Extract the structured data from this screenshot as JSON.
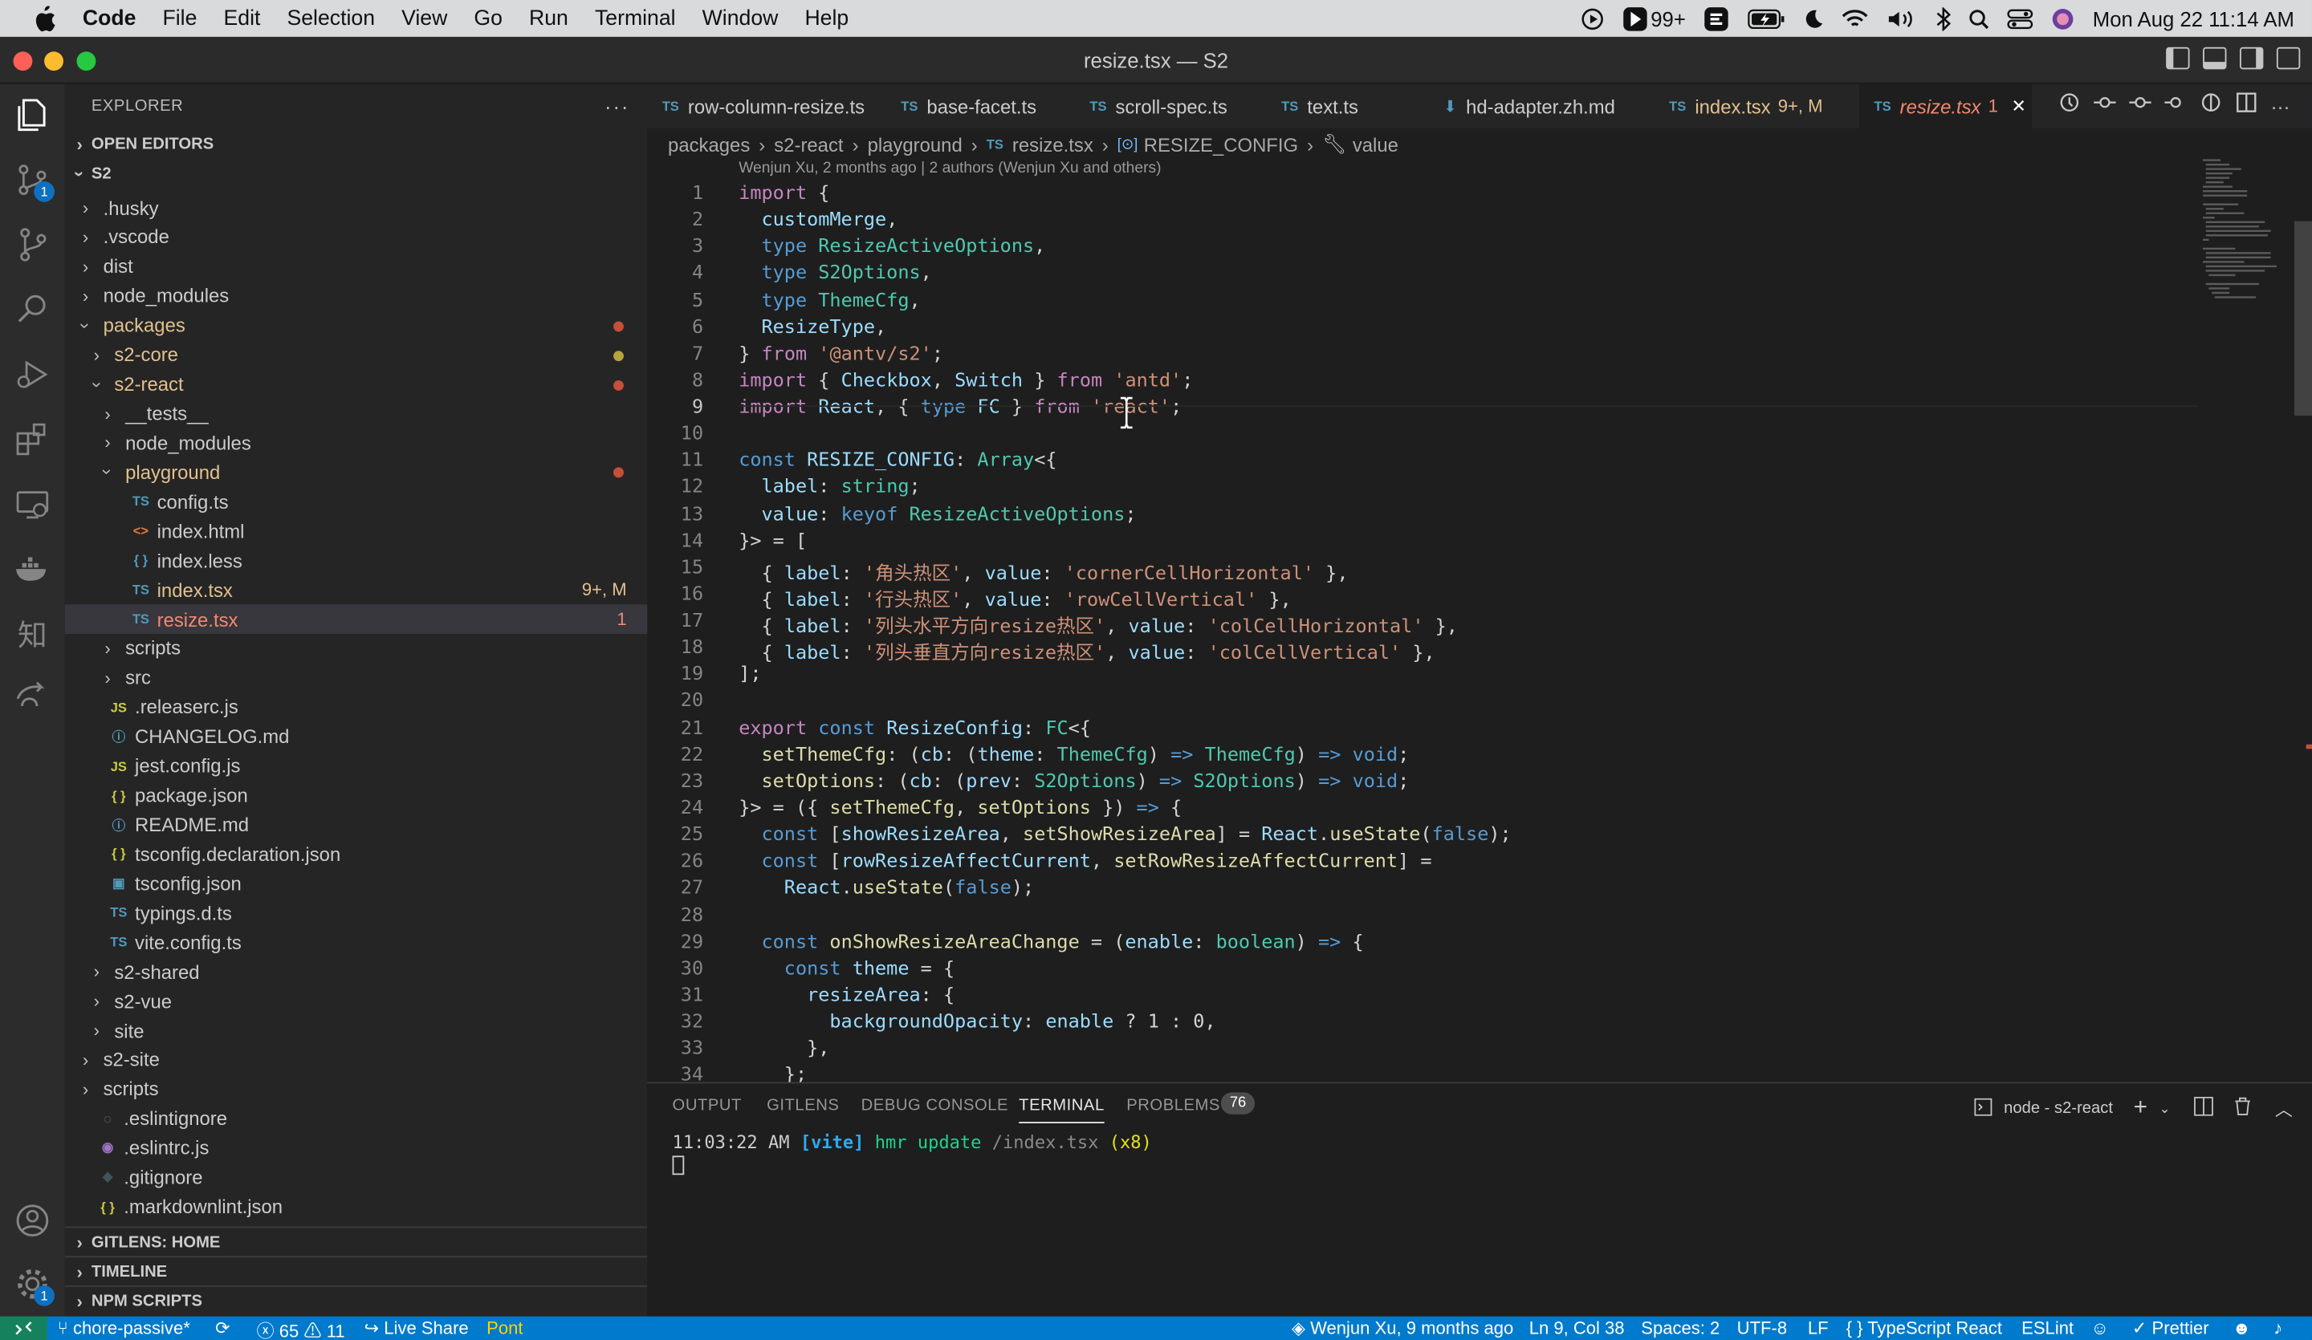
{
  "menubar": {
    "items": [
      "Code",
      "File",
      "Edit",
      "Selection",
      "View",
      "Go",
      "Run",
      "Terminal",
      "Window",
      "Help"
    ],
    "notifications": "99+",
    "datetime": "Mon Aug 22  11:14 AM"
  },
  "window": {
    "title": "resize.tsx — S2"
  },
  "sidebar": {
    "header": "EXPLORER",
    "open_editors": "OPEN EDITORS",
    "root": "S2",
    "tree": [
      {
        "name": ".husky",
        "type": "folder",
        "depth": 1
      },
      {
        "name": ".vscode",
        "type": "folder",
        "depth": 1
      },
      {
        "name": "dist",
        "type": "folder",
        "depth": 1
      },
      {
        "name": "node_modules",
        "type": "folder",
        "depth": 1
      },
      {
        "name": "packages",
        "type": "folder-open",
        "depth": 1,
        "color": "#e2c08d",
        "dot": "#c74e39"
      },
      {
        "name": "s2-core",
        "type": "folder",
        "depth": 2,
        "color": "#e2c08d",
        "dot": "#b5a33f"
      },
      {
        "name": "s2-react",
        "type": "folder-open",
        "depth": 2,
        "color": "#e2c08d",
        "dot": "#c74e39"
      },
      {
        "name": "__tests__",
        "type": "folder",
        "depth": 3
      },
      {
        "name": "node_modules",
        "type": "folder",
        "depth": 3
      },
      {
        "name": "playground",
        "type": "folder-open",
        "depth": 3,
        "color": "#e2c08d",
        "dot": "#c74e39"
      },
      {
        "name": "config.ts",
        "type": "TS",
        "depth": 4
      },
      {
        "name": "index.html",
        "type": "HTML",
        "depth": 4
      },
      {
        "name": "index.less",
        "type": "LESS",
        "depth": 4
      },
      {
        "name": "index.tsx",
        "type": "TS",
        "depth": 4,
        "color": "#e2c08d",
        "deco": "9+, M"
      },
      {
        "name": "resize.tsx",
        "type": "TS",
        "depth": 4,
        "color": "#f48771",
        "deco": "1",
        "selected": true
      },
      {
        "name": "scripts",
        "type": "folder",
        "depth": 3
      },
      {
        "name": "src",
        "type": "folder",
        "depth": 3
      },
      {
        "name": ".releaserc.js",
        "type": "JS",
        "depth": 2
      },
      {
        "name": "CHANGELOG.md",
        "type": "INFO",
        "depth": 2
      },
      {
        "name": "jest.config.js",
        "type": "JS",
        "depth": 2
      },
      {
        "name": "package.json",
        "type": "JSON",
        "depth": 2
      },
      {
        "name": "README.md",
        "type": "INFO",
        "depth": 2
      },
      {
        "name": "tsconfig.declaration.json",
        "type": "JSON",
        "depth": 2
      },
      {
        "name": "tsconfig.json",
        "type": "TSCONF",
        "depth": 2
      },
      {
        "name": "typings.d.ts",
        "type": "TS",
        "depth": 2
      },
      {
        "name": "vite.config.ts",
        "type": "TS",
        "depth": 2
      },
      {
        "name": "s2-shared",
        "type": "folder",
        "depth": 2
      },
      {
        "name": "s2-vue",
        "type": "folder",
        "depth": 2
      },
      {
        "name": "site",
        "type": "folder",
        "depth": 2
      },
      {
        "name": "s2-site",
        "type": "folder",
        "depth": 1
      },
      {
        "name": "scripts",
        "type": "folder",
        "depth": 1
      },
      {
        "name": ".eslintignore",
        "type": "IGNORE",
        "depth": 1
      },
      {
        "name": ".eslintrc.js",
        "type": "ESLINT",
        "depth": 1
      },
      {
        "name": ".gitignore",
        "type": "GIT",
        "depth": 1
      },
      {
        "name": ".markdownlint.json",
        "type": "JSON",
        "depth": 1
      }
    ],
    "sections": [
      "GITLENS: HOME",
      "TIMELINE",
      "NPM SCRIPTS"
    ]
  },
  "tabs": [
    {
      "label": "row-column-resize.ts",
      "icon": "TS"
    },
    {
      "label": "base-facet.ts",
      "icon": "TS"
    },
    {
      "label": "scroll-spec.ts",
      "icon": "TS"
    },
    {
      "label": "text.ts",
      "icon": "TS"
    },
    {
      "label": "hd-adapter.zh.md",
      "icon": "MD"
    },
    {
      "label": "index.tsx",
      "icon": "TS",
      "deco": "9+, M"
    },
    {
      "label": "resize.tsx",
      "icon": "TS",
      "deco": "1",
      "active": true
    },
    {
      "label": "",
      "icon": "T"
    }
  ],
  "breadcrumb": [
    "packages",
    "s2-react",
    "playground",
    "resize.tsx",
    "RESIZE_CONFIG",
    "value"
  ],
  "blame": "Wenjun Xu, 2 months ago | 2 authors (Wenjun Xu and others)",
  "code_lines": [
    [
      [
        "kw",
        "import"
      ],
      [
        "p",
        " {"
      ]
    ],
    [
      [
        "v",
        "  customMerge"
      ],
      [
        "p",
        ","
      ]
    ],
    [
      [
        "k",
        "  type "
      ],
      [
        "t",
        "ResizeActiveOptions"
      ],
      [
        "p",
        ","
      ]
    ],
    [
      [
        "k",
        "  type "
      ],
      [
        "t",
        "S2Options"
      ],
      [
        "p",
        ","
      ]
    ],
    [
      [
        "k",
        "  type "
      ],
      [
        "t",
        "ThemeCfg"
      ],
      [
        "p",
        ","
      ]
    ],
    [
      [
        "v",
        "  ResizeType"
      ],
      [
        "p",
        ","
      ]
    ],
    [
      [
        "p",
        "} "
      ],
      [
        "kw",
        "from"
      ],
      [
        "s",
        " '@antv/s2'"
      ],
      [
        "p",
        ";"
      ]
    ],
    [
      [
        "kw",
        "import"
      ],
      [
        "p",
        " { "
      ],
      [
        "v",
        "Checkbox"
      ],
      [
        "p",
        ", "
      ],
      [
        "v",
        "Switch"
      ],
      [
        "p",
        " } "
      ],
      [
        "kw",
        "from"
      ],
      [
        "s",
        " 'antd'"
      ],
      [
        "p",
        ";"
      ]
    ],
    [
      [
        "kw",
        "import"
      ],
      [
        "v",
        " React"
      ],
      [
        "p",
        ", { "
      ],
      [
        "k",
        "type "
      ],
      [
        "v",
        "FC"
      ],
      [
        "p",
        " } "
      ],
      [
        "kw",
        "from"
      ],
      [
        "s",
        " 'react'"
      ],
      [
        "p",
        ";"
      ]
    ],
    [],
    [
      [
        "k",
        "const "
      ],
      [
        "v",
        "RESIZE_CONFIG"
      ],
      [
        "p",
        ": "
      ],
      [
        "t",
        "Array"
      ],
      [
        "p",
        "<{"
      ]
    ],
    [
      [
        "v",
        "  label"
      ],
      [
        "p",
        ": "
      ],
      [
        "t",
        "string"
      ],
      [
        "p",
        ";"
      ]
    ],
    [
      [
        "v",
        "  value"
      ],
      [
        "p",
        ": "
      ],
      [
        "k",
        "keyof "
      ],
      [
        "t",
        "ResizeActiveOptions"
      ],
      [
        "p",
        ";"
      ]
    ],
    [
      [
        "p",
        "}> = ["
      ]
    ],
    [
      [
        "p",
        "  { "
      ],
      [
        "v",
        "label"
      ],
      [
        "p",
        ": "
      ],
      [
        "s",
        "'角头热区'"
      ],
      [
        "p",
        ", "
      ],
      [
        "v",
        "value"
      ],
      [
        "p",
        ": "
      ],
      [
        "s",
        "'cornerCellHorizontal'"
      ],
      [
        "p",
        " },"
      ]
    ],
    [
      [
        "p",
        "  { "
      ],
      [
        "v",
        "label"
      ],
      [
        "p",
        ": "
      ],
      [
        "s",
        "'行头热区'"
      ],
      [
        "p",
        ", "
      ],
      [
        "v",
        "value"
      ],
      [
        "p",
        ": "
      ],
      [
        "s",
        "'rowCellVertical'"
      ],
      [
        "p",
        " },"
      ]
    ],
    [
      [
        "p",
        "  { "
      ],
      [
        "v",
        "label"
      ],
      [
        "p",
        ": "
      ],
      [
        "s",
        "'列头水平方向resize热区'"
      ],
      [
        "p",
        ", "
      ],
      [
        "v",
        "value"
      ],
      [
        "p",
        ": "
      ],
      [
        "s",
        "'colCellHorizontal'"
      ],
      [
        "p",
        " },"
      ]
    ],
    [
      [
        "p",
        "  { "
      ],
      [
        "v",
        "label"
      ],
      [
        "p",
        ": "
      ],
      [
        "s",
        "'列头垂直方向resize热区'"
      ],
      [
        "p",
        ", "
      ],
      [
        "v",
        "value"
      ],
      [
        "p",
        ": "
      ],
      [
        "s",
        "'colCellVertical'"
      ],
      [
        "p",
        " },"
      ]
    ],
    [
      [
        "p",
        "];"
      ]
    ],
    [],
    [
      [
        "kw",
        "export "
      ],
      [
        "k",
        "const "
      ],
      [
        "v",
        "ResizeConfig"
      ],
      [
        "p",
        ": "
      ],
      [
        "t",
        "FC"
      ],
      [
        "p",
        "<{"
      ]
    ],
    [
      [
        "f",
        "  setThemeCfg"
      ],
      [
        "p",
        ": ("
      ],
      [
        "v",
        "cb"
      ],
      [
        "p",
        ": ("
      ],
      [
        "v",
        "theme"
      ],
      [
        "p",
        ": "
      ],
      [
        "t",
        "ThemeCfg"
      ],
      [
        "p",
        ") "
      ],
      [
        "k",
        "=>"
      ],
      [
        "t",
        " ThemeCfg"
      ],
      [
        "p",
        ") "
      ],
      [
        "k",
        "=>"
      ],
      [
        "k",
        " void"
      ],
      [
        "p",
        ";"
      ]
    ],
    [
      [
        "f",
        "  setOptions"
      ],
      [
        "p",
        ": ("
      ],
      [
        "v",
        "cb"
      ],
      [
        "p",
        ": ("
      ],
      [
        "v",
        "prev"
      ],
      [
        "p",
        ": "
      ],
      [
        "t",
        "S2Options"
      ],
      [
        "p",
        ") "
      ],
      [
        "k",
        "=>"
      ],
      [
        "t",
        " S2Options"
      ],
      [
        "p",
        ") "
      ],
      [
        "k",
        "=>"
      ],
      [
        "k",
        " void"
      ],
      [
        "p",
        ";"
      ]
    ],
    [
      [
        "p",
        "}> = ({ "
      ],
      [
        "f",
        "setThemeCfg"
      ],
      [
        "p",
        ", "
      ],
      [
        "f",
        "setOptions"
      ],
      [
        "p",
        " }) "
      ],
      [
        "k",
        "=>"
      ],
      [
        "p",
        " {"
      ]
    ],
    [
      [
        "k",
        "  const "
      ],
      [
        "p",
        "["
      ],
      [
        "v",
        "showResizeArea"
      ],
      [
        "p",
        ", "
      ],
      [
        "f",
        "setShowResizeArea"
      ],
      [
        "p",
        "] = "
      ],
      [
        "v",
        "React"
      ],
      [
        "p",
        "."
      ],
      [
        "f",
        "useState"
      ],
      [
        "p",
        "("
      ],
      [
        "k",
        "false"
      ],
      [
        "p",
        ");"
      ]
    ],
    [
      [
        "k",
        "  const "
      ],
      [
        "p",
        "["
      ],
      [
        "v",
        "rowResizeAffectCurrent"
      ],
      [
        "p",
        ", "
      ],
      [
        "f",
        "setRowResizeAffectCurrent"
      ],
      [
        "p",
        "] ="
      ]
    ],
    [
      [
        "v",
        "    React"
      ],
      [
        "p",
        "."
      ],
      [
        "f",
        "useState"
      ],
      [
        "p",
        "("
      ],
      [
        "k",
        "false"
      ],
      [
        "p",
        ");"
      ]
    ],
    [],
    [
      [
        "k",
        "  const "
      ],
      [
        "f",
        "onShowResizeAreaChange"
      ],
      [
        "p",
        " = ("
      ],
      [
        "v",
        "enable"
      ],
      [
        "p",
        ": "
      ],
      [
        "t",
        "boolean"
      ],
      [
        "p",
        ") "
      ],
      [
        "k",
        "=>"
      ],
      [
        "p",
        " {"
      ]
    ],
    [
      [
        "k",
        "    const "
      ],
      [
        "v",
        "theme"
      ],
      [
        "p",
        " = {"
      ]
    ],
    [
      [
        "v",
        "      resizeArea"
      ],
      [
        "p",
        ": {"
      ]
    ],
    [
      [
        "v",
        "        backgroundOpacity"
      ],
      [
        "p",
        ": "
      ],
      [
        "v",
        "enable"
      ],
      [
        "p",
        " ? 1 : 0,"
      ]
    ],
    [
      [
        "p",
        "      },"
      ]
    ],
    [
      [
        "p",
        "    };"
      ]
    ]
  ],
  "panel": {
    "tabs": [
      "OUTPUT",
      "GITLENS",
      "DEBUG CONSOLE",
      "TERMINAL",
      "PROBLEMS"
    ],
    "problems_count": "76",
    "active_tab": "TERMINAL",
    "terminal_name": "node - s2-react",
    "terminal_line": {
      "time": "11:03:22 AM",
      "tag": "[vite]",
      "msg": "hmr update",
      "path": "/index.tsx",
      "count": "(x8)"
    }
  },
  "statusbar": {
    "branch": "chore-passive*",
    "errors": "65",
    "warnings": "11",
    "live_share": "Live Share",
    "pont": "Pont",
    "blame": "Wenjun Xu, 9 months ago",
    "position": "Ln 9, Col 38",
    "spaces": "Spaces: 2",
    "encoding": "UTF-8",
    "eol": "LF",
    "language": "TypeScript React",
    "eslint": "ESLint",
    "prettier": "Prettier"
  },
  "colors": {
    "accent": "#007acc",
    "background": "#1e1e1e",
    "sidebar": "#252526"
  }
}
